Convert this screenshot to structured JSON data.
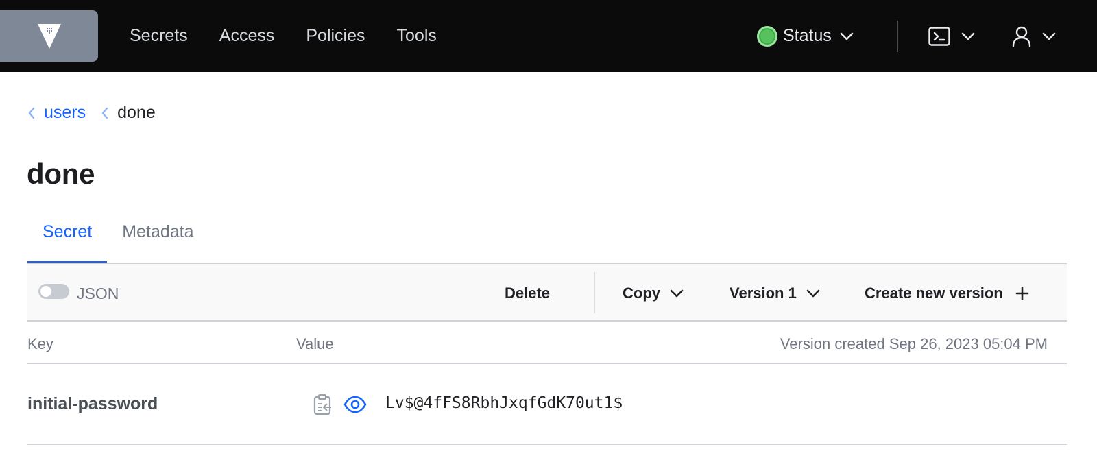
{
  "nav": {
    "links": [
      "Secrets",
      "Access",
      "Policies",
      "Tools"
    ],
    "status_label": "Status",
    "status_color": "#56c25e",
    "console_icon": "terminal-icon",
    "user_icon": "user-icon"
  },
  "breadcrumb": {
    "parent": "users",
    "current": "done"
  },
  "page": {
    "title": "done"
  },
  "tabs": [
    {
      "label": "Secret",
      "active": true
    },
    {
      "label": "Metadata",
      "active": false
    }
  ],
  "toolbar": {
    "json_toggle_label": "JSON",
    "json_toggle_on": false,
    "delete_label": "Delete",
    "copy_label": "Copy",
    "version_label": "Version 1",
    "create_label": "Create new version"
  },
  "table": {
    "headers": {
      "key": "Key",
      "value": "Value",
      "version_created": "Version created Sep 26, 2023 05:04 PM"
    },
    "rows": [
      {
        "key": "initial-password",
        "value": "Lv$@4fFS8RbhJxqfGdK70ut1$"
      }
    ]
  },
  "colors": {
    "accent": "#1563ff",
    "nav_bg": "#0b0b0c",
    "logo_bg": "#7e8896"
  }
}
